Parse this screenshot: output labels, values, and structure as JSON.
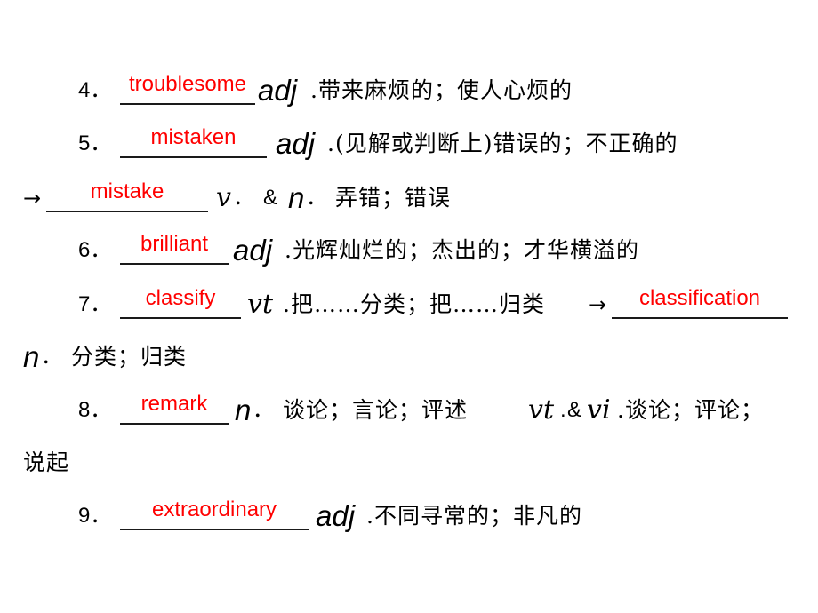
{
  "items": [
    {
      "number": "4．",
      "answer": "troublesome",
      "pos": "adj",
      "definition": ".带来麻烦的；使人心烦的"
    },
    {
      "number": "5．",
      "answer": "mistaken",
      "pos": "adj",
      "definition": ".(见解或判断上)错误的；不正确的",
      "derived": {
        "arrow": "→",
        "answer": "mistake",
        "pos_v": "v",
        "sep1": "．",
        "amp": "&",
        "pos_n": "n",
        "sep2": "．",
        "definition": "弄错；错误"
      }
    },
    {
      "number": "6．",
      "answer": "brilliant",
      "pos": "adj",
      "definition": ".光辉灿烂的；杰出的；才华横溢的"
    },
    {
      "number": "7．",
      "answer": "classify",
      "pos": "vt",
      "definition": ".把……分类；把……归类",
      "arrow": "→",
      "derived": {
        "answer": "classification",
        "pos": "n",
        "sep": "．",
        "definition": "分类；归类"
      }
    },
    {
      "number": "8．",
      "answer": "remark",
      "pos": "n",
      "sep": "．",
      "definition": "谈论；言论；评述",
      "pos2": "vt",
      "dot2": ".",
      "amp": "&",
      "pos3": "vi",
      "definition2": ".谈论；评论；",
      "continuation": "说起"
    },
    {
      "number": "9．",
      "answer": "extraordinary",
      "pos": "adj",
      "definition": ".不同寻常的；非凡的"
    }
  ],
  "colors": {
    "answer": "#ff0000",
    "text": "#000000",
    "background": "#ffffff"
  }
}
